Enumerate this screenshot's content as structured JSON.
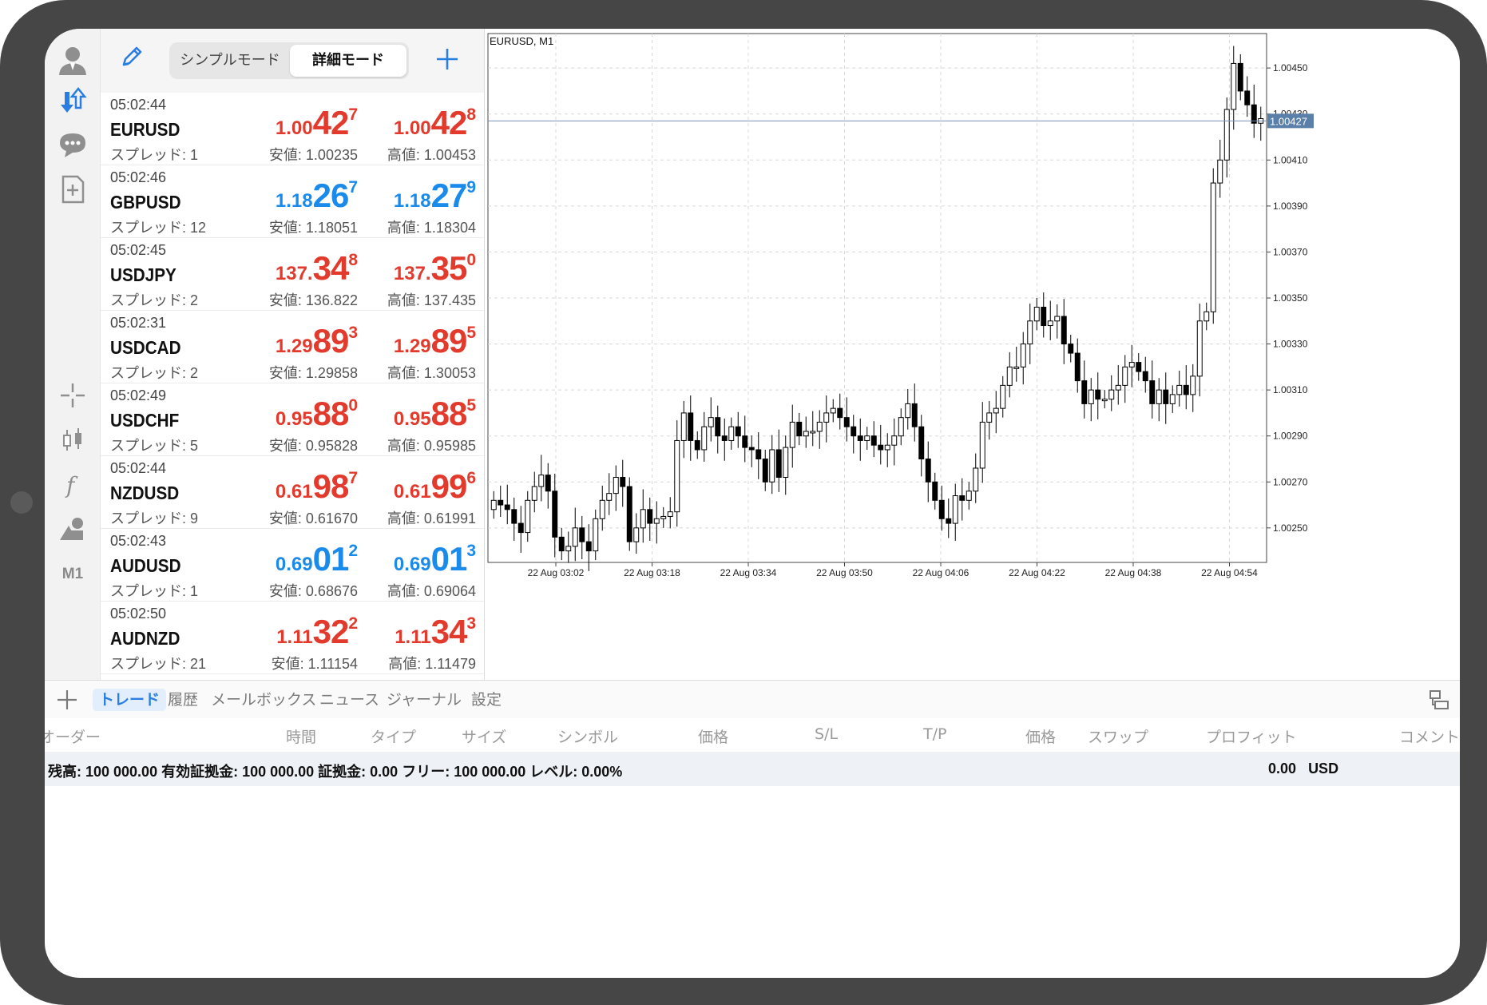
{
  "icons": {
    "account": "person-icon",
    "trade": "arrows-updown-icon",
    "chat": "chat-bubble-icon",
    "new_order": "add-document-icon",
    "crosshair": "crosshair-icon",
    "chart_type": "candlestick-icon",
    "indicators": "function-icon",
    "objects": "shapes-icon"
  },
  "sidebar": {
    "timeframe": "M1"
  },
  "quotes": {
    "mode_simple": "シンプルモード",
    "mode_advanced": "詳細モード",
    "items": [
      {
        "time": "05:02:44",
        "symbol": "EURUSD",
        "spread": "スプレッド: 1",
        "low": "安値: 1.00235",
        "high": "高値: 1.00453",
        "bid": [
          "1.00",
          "42",
          "7"
        ],
        "ask": [
          "1.00",
          "42",
          "8"
        ],
        "dir": "dn"
      },
      {
        "time": "05:02:46",
        "symbol": "GBPUSD",
        "spread": "スプレッド: 12",
        "low": "安値: 1.18051",
        "high": "高値: 1.18304",
        "bid": [
          "1.18",
          "26",
          "7"
        ],
        "ask": [
          "1.18",
          "27",
          "9"
        ],
        "dir": "up"
      },
      {
        "time": "05:02:45",
        "symbol": "USDJPY",
        "spread": "スプレッド: 2",
        "low": "安値: 136.822",
        "high": "高値: 137.435",
        "bid": [
          "137.",
          "34",
          "8"
        ],
        "ask": [
          "137.",
          "35",
          "0"
        ],
        "dir": "dn"
      },
      {
        "time": "05:02:31",
        "symbol": "USDCAD",
        "spread": "スプレッド: 2",
        "low": "安値: 1.29858",
        "high": "高値: 1.30053",
        "bid": [
          "1.29",
          "89",
          "3"
        ],
        "ask": [
          "1.29",
          "89",
          "5"
        ],
        "dir": "dn"
      },
      {
        "time": "05:02:49",
        "symbol": "USDCHF",
        "spread": "スプレッド: 5",
        "low": "安値: 0.95828",
        "high": "高値: 0.95985",
        "bid": [
          "0.95",
          "88",
          "0"
        ],
        "ask": [
          "0.95",
          "88",
          "5"
        ],
        "dir": "dn"
      },
      {
        "time": "05:02:44",
        "symbol": "NZDUSD",
        "spread": "スプレッド: 9",
        "low": "安値: 0.61670",
        "high": "高値: 0.61991",
        "bid": [
          "0.61",
          "98",
          "7"
        ],
        "ask": [
          "0.61",
          "99",
          "6"
        ],
        "dir": "dn"
      },
      {
        "time": "05:02:43",
        "symbol": "AUDUSD",
        "spread": "スプレッド: 1",
        "low": "安値: 0.68676",
        "high": "高値: 0.69064",
        "bid": [
          "0.69",
          "01",
          "2"
        ],
        "ask": [
          "0.69",
          "01",
          "3"
        ],
        "dir": "up"
      },
      {
        "time": "05:02:50",
        "symbol": "AUDNZD",
        "spread": "スプレッド: 21",
        "low": "安値: 1.11154",
        "high": "高値: 1.11479",
        "bid": [
          "1.11",
          "32",
          "2"
        ],
        "ask": [
          "1.11",
          "34",
          "3"
        ],
        "dir": "dn"
      }
    ]
  },
  "chart": {
    "title": "EURUSD, M1",
    "current_price": "1.00427"
  },
  "chart_data": {
    "type": "candlestick",
    "title": "EURUSD, M1",
    "ylim": [
      1.00235,
      1.00465
    ],
    "y_ticks": [
      "1.00450",
      "1.00430",
      "1.00410",
      "1.00390",
      "1.00370",
      "1.00350",
      "1.00330",
      "1.00310",
      "1.00290",
      "1.00270",
      "1.00250"
    ],
    "x_ticks": [
      "22 Aug 03:02",
      "22 Aug 03:18",
      "22 Aug 03:34",
      "22 Aug 03:50",
      "22 Aug 04:06",
      "22 Aug 04:22",
      "22 Aug 04:38",
      "22 Aug 04:54"
    ],
    "current_price": 1.00427,
    "close_series": [
      1.00262,
      1.0026,
      1.00258,
      1.00252,
      1.00248,
      1.00262,
      1.00268,
      1.00273,
      1.00266,
      1.00246,
      1.0024,
      1.00242,
      1.0025,
      1.00244,
      1.0024,
      1.00254,
      1.00262,
      1.00265,
      1.00272,
      1.00268,
      1.00244,
      1.0025,
      1.00258,
      1.00252,
      1.00254,
      1.00255,
      1.00257,
      1.00288,
      1.003,
      1.00288,
      1.00284,
      1.00294,
      1.00298,
      1.0029,
      1.00288,
      1.00294,
      1.0029,
      1.00285,
      1.00284,
      1.0028,
      1.0027,
      1.00284,
      1.00272,
      1.00285,
      1.00296,
      1.0029,
      1.00292,
      1.00292,
      1.00296,
      1.003,
      1.00302,
      1.00298,
      1.00294,
      1.0029,
      1.00288,
      1.0029,
      1.00286,
      1.00284,
      1.00286,
      1.0029,
      1.00298,
      1.00304,
      1.00294,
      1.0028,
      1.0027,
      1.00262,
      1.00254,
      1.00252,
      1.00264,
      1.00262,
      1.00266,
      1.00276,
      1.00296,
      1.003,
      1.00302,
      1.00312,
      1.0032,
      1.0032,
      1.0033,
      1.0034,
      1.00346,
      1.00338,
      1.0034,
      1.00342,
      1.0033,
      1.00326,
      1.00314,
      1.00304,
      1.0031,
      1.00306,
      1.00306,
      1.0031,
      1.00312,
      1.0032,
      1.00322,
      1.00318,
      1.00314,
      1.00304,
      1.0031,
      1.00304,
      1.00308,
      1.00312,
      1.00308,
      1.00316,
      1.0034,
      1.00344,
      1.004,
      1.0041,
      1.00432,
      1.00452,
      1.0044,
      1.00434,
      1.00426,
      1.00428
    ]
  },
  "bottom": {
    "tabs": [
      "トレード",
      "履歴",
      "メールボックス",
      "ニュース",
      "ジャーナル",
      "設定"
    ],
    "columns": [
      "オーダー",
      "時間",
      "タイプ",
      "サイズ",
      "シンボル",
      "価格",
      "S/L",
      "T/P",
      "価格",
      "スワップ",
      "プロフィット",
      "コメント"
    ],
    "summary": "残高: 100 000.00 有効証拠金: 100 000.00 証拠金: 0.00 フリー: 100 000.00 レベル: 0.00%",
    "profit": "0.00",
    "currency": "USD"
  },
  "colors": {
    "up": "#1a8aeb",
    "down": "#e23a2c",
    "price_line": "#7890b0",
    "price_tag": "#5a7fa8"
  }
}
